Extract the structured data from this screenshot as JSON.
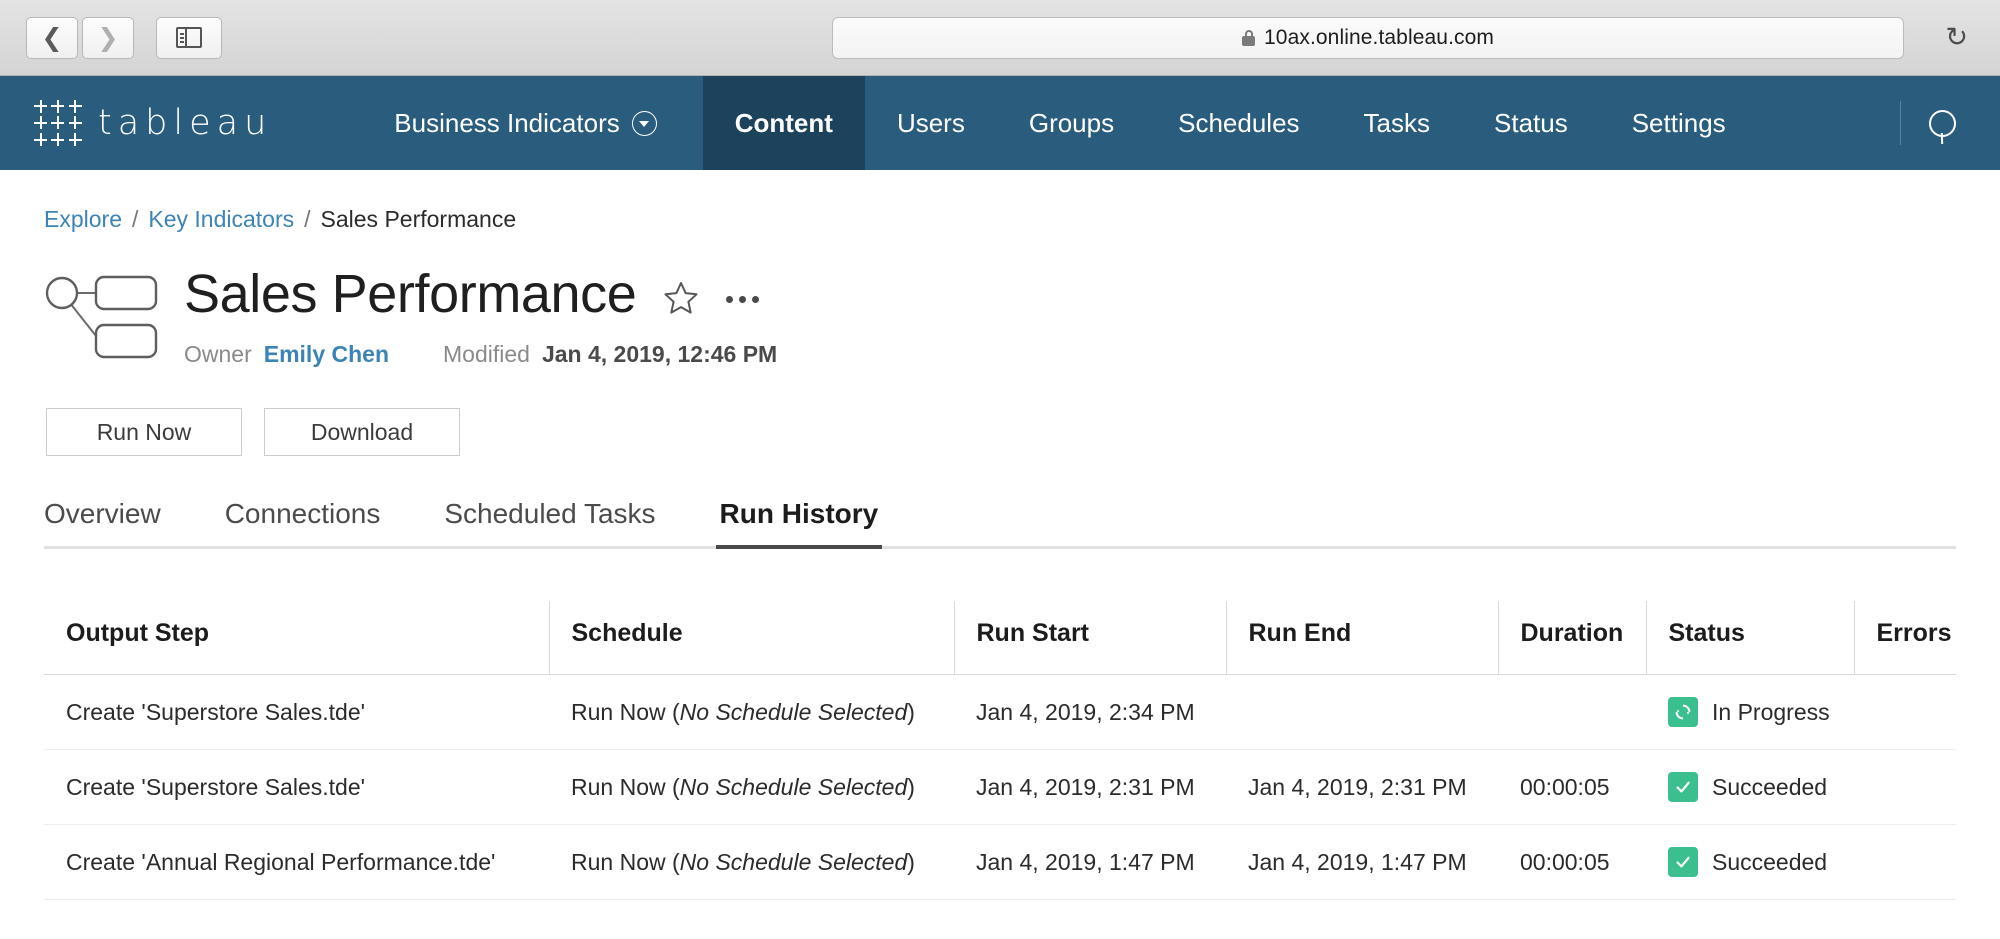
{
  "browser": {
    "back_label": "Back",
    "forward_label": "Forward",
    "sidebar_label": "Show Sidebar",
    "url": "10ax.online.tableau.com",
    "reload_label": "Reload"
  },
  "topnav": {
    "brand": "tableau",
    "site_selector": "Business Indicators",
    "links": [
      {
        "label": "Content",
        "active": true
      },
      {
        "label": "Users",
        "active": false
      },
      {
        "label": "Groups",
        "active": false
      },
      {
        "label": "Schedules",
        "active": false
      },
      {
        "label": "Tasks",
        "active": false
      },
      {
        "label": "Status",
        "active": false
      },
      {
        "label": "Settings",
        "active": false
      }
    ],
    "search_label": "Search"
  },
  "breadcrumb": {
    "items": [
      "Explore",
      "Key Indicators",
      "Sales Performance"
    ],
    "separator": "/"
  },
  "header": {
    "title": "Sales Performance",
    "owner_label": "Owner",
    "owner_name": "Emily Chen",
    "modified_label": "Modified",
    "modified_value": "Jan 4, 2019, 12:46 PM",
    "favorite_label": "Add to Favorites",
    "more_label": "More Actions"
  },
  "actions": {
    "run_now": "Run Now",
    "download": "Download"
  },
  "tabs": [
    {
      "label": "Overview",
      "active": false
    },
    {
      "label": "Connections",
      "active": false
    },
    {
      "label": "Scheduled Tasks",
      "active": false
    },
    {
      "label": "Run History",
      "active": true
    }
  ],
  "table": {
    "columns": [
      "Output Step",
      "Schedule",
      "Run Start",
      "Run End",
      "Duration",
      "Status",
      "Errors"
    ],
    "rows": [
      {
        "output_step": "Create 'Superstore Sales.tde'",
        "schedule_prefix": "Run Now (",
        "schedule_italic": "No Schedule Selected",
        "schedule_suffix": ")",
        "run_start": "Jan 4, 2019, 2:34 PM",
        "run_end": "",
        "duration": "",
        "status": "In Progress",
        "status_icon": "refresh-icon",
        "errors": ""
      },
      {
        "output_step": "Create 'Superstore Sales.tde'",
        "schedule_prefix": "Run Now (",
        "schedule_italic": "No Schedule Selected",
        "schedule_suffix": ")",
        "run_start": "Jan 4, 2019, 2:31 PM",
        "run_end": "Jan 4, 2019, 2:31 PM",
        "duration": "00:00:05",
        "status": "Succeeded",
        "status_icon": "check-icon",
        "errors": ""
      },
      {
        "output_step": "Create 'Annual Regional Performance.tde'",
        "schedule_prefix": "Run Now (",
        "schedule_italic": "No Schedule Selected",
        "schedule_suffix": ")",
        "run_start": "Jan 4, 2019, 1:47 PM",
        "run_end": "Jan 4, 2019, 1:47 PM",
        "duration": "00:00:05",
        "status": "Succeeded",
        "status_icon": "check-icon",
        "errors": ""
      }
    ]
  },
  "colors": {
    "nav_blue": "#2a5c7d",
    "nav_active_blue": "#1c425c",
    "link_blue": "#3c84b5",
    "status_green": "#3cbf8e"
  }
}
